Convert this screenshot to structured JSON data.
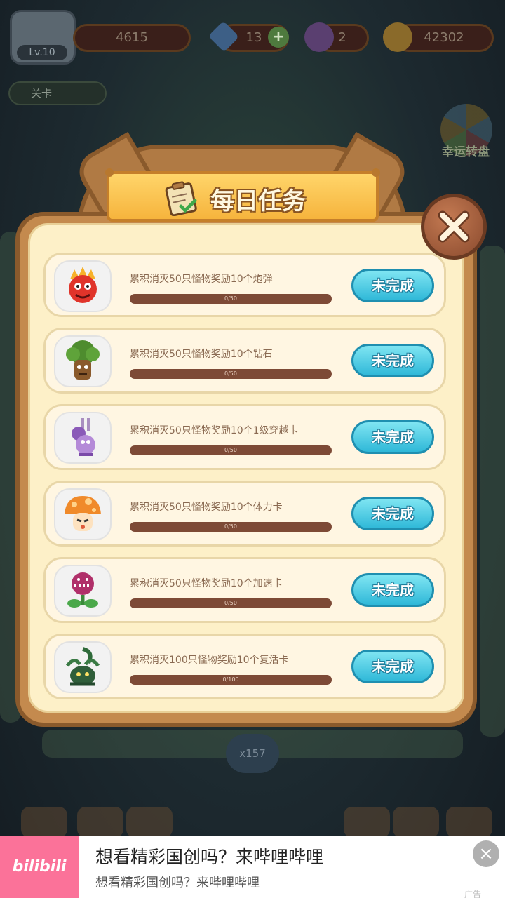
{
  "hud": {
    "level": "Lv.10",
    "power": "4615",
    "diamonds": "13",
    "potion": "2",
    "coins": "42302",
    "stage_label": "关卡"
  },
  "side": {
    "lucky_wheel_label": "幸运转盘"
  },
  "background": {
    "monster_counter": "x157"
  },
  "dialog": {
    "title": "每日任务",
    "tasks": [
      {
        "text": "累积消灭50只怪物奖励10个炮弹",
        "progress_text": "0/50",
        "progress": 0,
        "status": "未完成",
        "monster": "red-flame-devil-icon"
      },
      {
        "text": "累积消灭50只怪物奖励10个钻石",
        "progress_text": "0/50",
        "progress": 0,
        "status": "未完成",
        "monster": "tree-monster-icon"
      },
      {
        "text": "累积消灭50只怪物奖励10个1级穿越卡",
        "progress_text": "0/50",
        "progress": 0,
        "status": "未完成",
        "monster": "purple-bunny-monster-icon"
      },
      {
        "text": "累积消灭50只怪物奖励10个体力卡",
        "progress_text": "0/50",
        "progress": 0,
        "status": "未完成",
        "monster": "mushroom-monster-icon"
      },
      {
        "text": "累积消灭50只怪物奖励10个加速卡",
        "progress_text": "0/50",
        "progress": 0,
        "status": "未完成",
        "monster": "piranha-plant-icon"
      },
      {
        "text": "累积消灭100只怪物奖励10个复活卡",
        "progress_text": "0/100",
        "progress": 0,
        "status": "未完成",
        "monster": "vine-monster-icon"
      }
    ]
  },
  "ad": {
    "logo": "bilibili",
    "headline": "想看精彩国创吗？来哔哩哔哩",
    "subline": "想看精彩国创吗？来哔哩哔哩",
    "tag": "广告"
  },
  "colors": {
    "button_cyan": "#2fb8d8",
    "progress_track": "#7d4a36",
    "panel_cream": "#fdf0c8",
    "frame_brown": "#c48a4e",
    "brand_pink": "#fb7299"
  }
}
